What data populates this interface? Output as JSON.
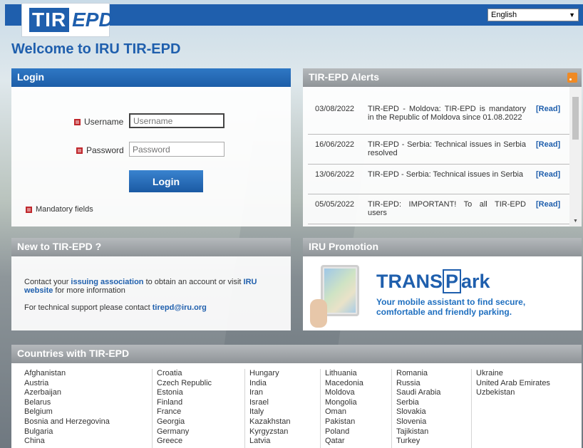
{
  "header": {
    "logo_tir": "TIR",
    "logo_epd": "EPD",
    "language": "English",
    "dropdown_arrow": "▼"
  },
  "welcome_title": "Welcome to IRU TIR-EPD",
  "login": {
    "title": "Login",
    "username_label": "Username",
    "username_placeholder": "Username",
    "password_label": "Password",
    "password_placeholder": "Password",
    "button_label": "Login",
    "mandatory_note": "Mandatory fields"
  },
  "alerts": {
    "title": "TIR-EPD Alerts",
    "read_label": "[Read]",
    "items": [
      {
        "date": "03/08/2022",
        "text": "TIR-EPD - Moldova: TIR-EPD is mandatory in the Republic of Moldova since 01.08.2022"
      },
      {
        "date": "16/06/2022",
        "text": "TIR-EPD - Serbia: Technical issues in Serbia resolved"
      },
      {
        "date": "13/06/2022",
        "text": "TIR-EPD - Serbia: Technical issues in Serbia"
      },
      {
        "date": "05/05/2022",
        "text": "TIR-EPD: IMPORTANT! To all TIR-EPD users"
      }
    ]
  },
  "new_to": {
    "title": "New to TIR-EPD ?",
    "line1_a": "Contact your ",
    "line1_link1": "issuing association",
    "line1_b": " to obtain an account or visit ",
    "line1_link2": "IRU website",
    "line1_c": " for more information",
    "line2_a": "For technical support please contact ",
    "line2_link": "tirepd@iru.org"
  },
  "promotion": {
    "title": "IRU Promotion",
    "brand_a": "TRANS",
    "brand_b": "P",
    "brand_c": "ark",
    "subtitle_1": "Your mobile assistant to find secure,",
    "subtitle_2": "comfortable and friendly parking."
  },
  "countries": {
    "title": "Countries with TIR-EPD",
    "columns": [
      [
        "Afghanistan",
        "Austria",
        "Azerbaijan",
        "Belarus",
        "Belgium",
        "Bosnia and Herzegovina",
        "Bulgaria",
        "China"
      ],
      [
        "Croatia",
        "Czech Republic",
        "Estonia",
        "Finland",
        "France",
        "Georgia",
        "Germany",
        "Greece"
      ],
      [
        "Hungary",
        "India",
        "Iran",
        "Israel",
        "Italy",
        "Kazakhstan",
        "Kyrgyzstan",
        "Latvia"
      ],
      [
        "Lithuania",
        "Macedonia",
        "Moldova",
        "Mongolia",
        "Oman",
        "Pakistan",
        "Poland",
        "Qatar"
      ],
      [
        "Romania",
        "Russia",
        "Saudi Arabia",
        "Serbia",
        "Slovakia",
        "Slovenia",
        "Tajikistan",
        "Turkey"
      ],
      [
        "Ukraine",
        "United Arab Emirates",
        "Uzbekistan"
      ]
    ]
  }
}
